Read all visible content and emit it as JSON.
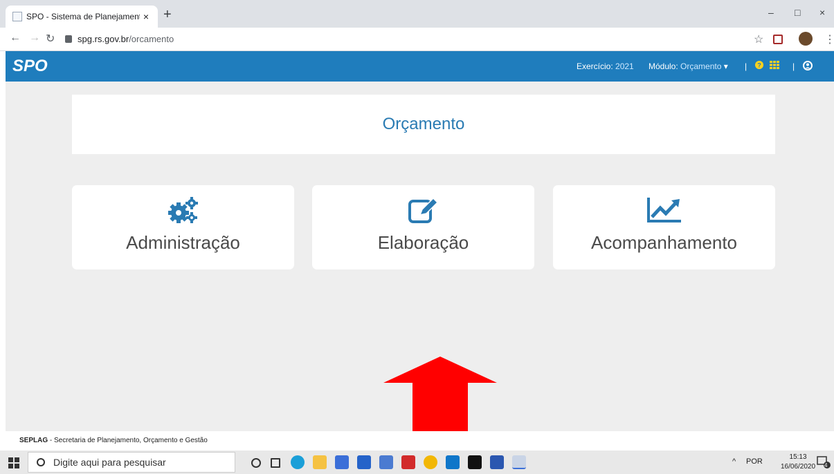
{
  "browser": {
    "tab_title": "SPO - Sistema de Planejamento e",
    "tab_close": "×",
    "new_tab": "+",
    "url_host": "spg.rs.gov.br",
    "url_path": "/orcamento",
    "window_controls": [
      "–",
      "□",
      "×"
    ]
  },
  "appbar": {
    "logo": "SPO",
    "exercicio_label": "Exercício:",
    "exercicio_value": "2021",
    "modulo_label": "Módulo:",
    "modulo_value": "Orçamento",
    "caret": "▾",
    "separator": "|",
    "bg_color": "#1f7dbd"
  },
  "page": {
    "title": "Orçamento",
    "cards": [
      {
        "label": "Administração",
        "icon": "gears-icon"
      },
      {
        "label": "Elaboração",
        "icon": "edit-icon"
      },
      {
        "label": "Acompanhamento",
        "icon": "line-chart-icon"
      }
    ],
    "arrow_color": "#ff0000"
  },
  "footer": {
    "org": "SEPLAG",
    "text": " - Secretaria de Planejamento, Orçamento e Gestão"
  },
  "taskbar": {
    "search_placeholder": "Digite aqui para pesquisar",
    "lang": "POR",
    "time": "15:13",
    "date": "16/06/2020",
    "notification_count": "4"
  }
}
